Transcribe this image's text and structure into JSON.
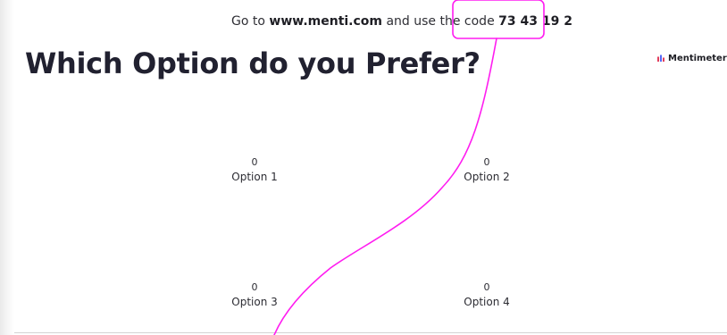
{
  "join": {
    "prefix": "Go to",
    "url": "www.menti.com",
    "middle": "and use the code",
    "code": "73 43 19 2"
  },
  "question": {
    "title": "Which Option do you Prefer?"
  },
  "brand": {
    "name": "Mentimeter",
    "colors": [
      "#e2405d",
      "#5568f5"
    ]
  },
  "options": [
    {
      "label": "Option 1",
      "count": "0"
    },
    {
      "label": "Option 2",
      "count": "0"
    },
    {
      "label": "Option 3",
      "count": "0"
    },
    {
      "label": "Option 4",
      "count": "0"
    }
  ],
  "annotation": {
    "color": "#ff1cf0",
    "shapes": [
      "rounded-rectangle",
      "curved-line"
    ]
  }
}
